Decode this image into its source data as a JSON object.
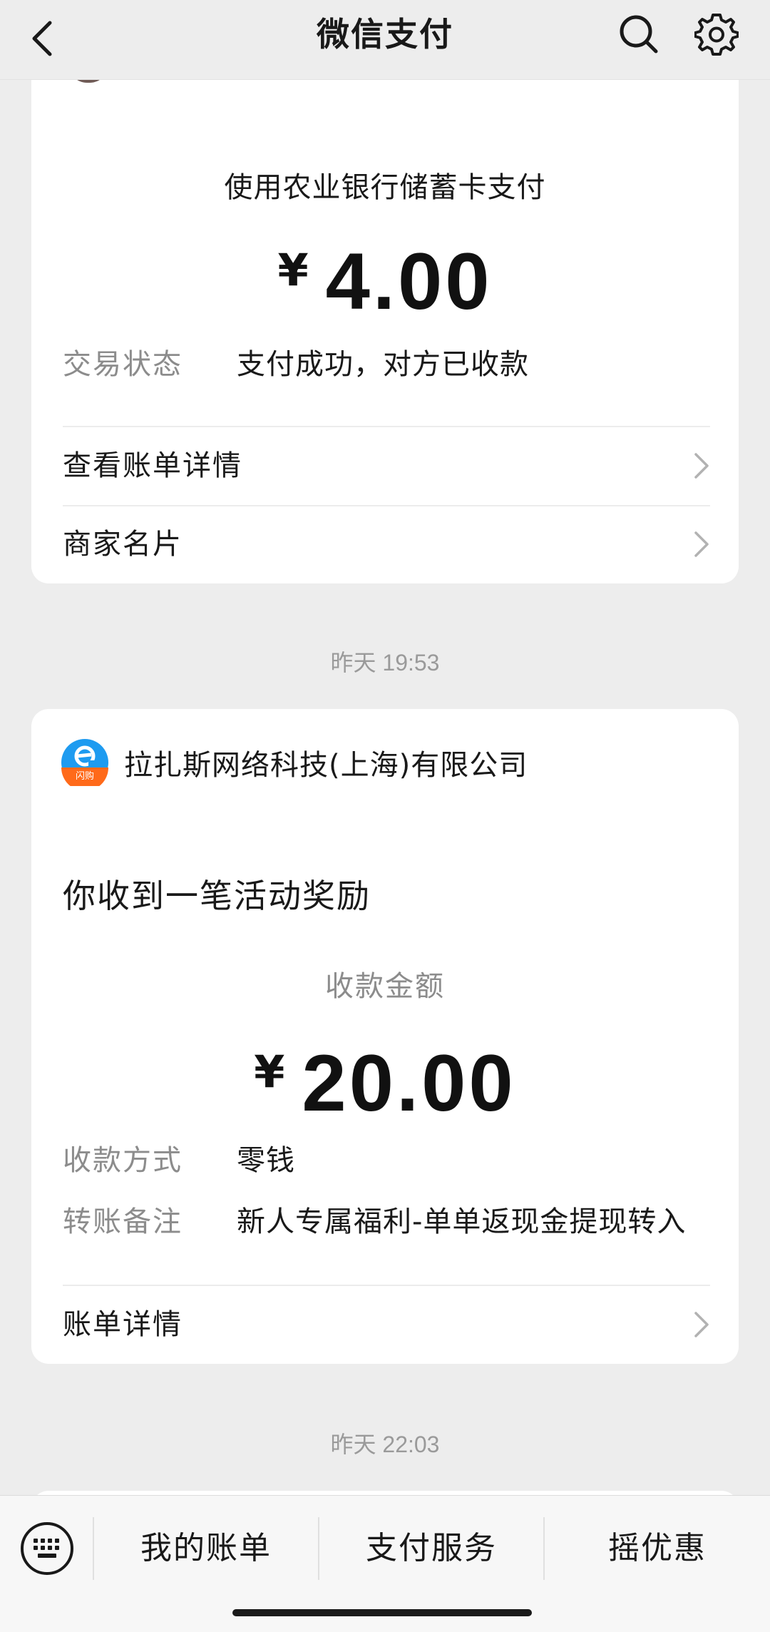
{
  "nav": {
    "title": "微信支付"
  },
  "payment_card": {
    "method": "使用农业银行储蓄卡支付",
    "currency": "¥",
    "amount": "4.00",
    "status_label": "交易状态",
    "status_value": "支付成功，对方已收款",
    "links": [
      "查看账单详情",
      "商家名片"
    ]
  },
  "timestamps": [
    "昨天 19:53",
    "昨天 22:03"
  ],
  "reward_card": {
    "merchant_name": "拉扎斯网络科技(上海)有限公司",
    "logo_badge": "闪购",
    "title": "你收到一笔活动奖励",
    "amount_label": "收款金额",
    "currency": "¥",
    "amount": "20.00",
    "method_label": "收款方式",
    "method_value": "零钱",
    "note_label": "转账备注",
    "note_value": "新人专属福利-单单返现金提现转入",
    "link": "账单详情"
  },
  "tabbar": {
    "tabs": [
      "我的账单",
      "支付服务",
      "摇优惠"
    ]
  },
  "colors": {
    "background": "#ededed",
    "card": "#ffffff",
    "label_gray": "#8c8c8c",
    "logo_blue": "#1e9bf0",
    "logo_orange": "#ff6a1a"
  }
}
